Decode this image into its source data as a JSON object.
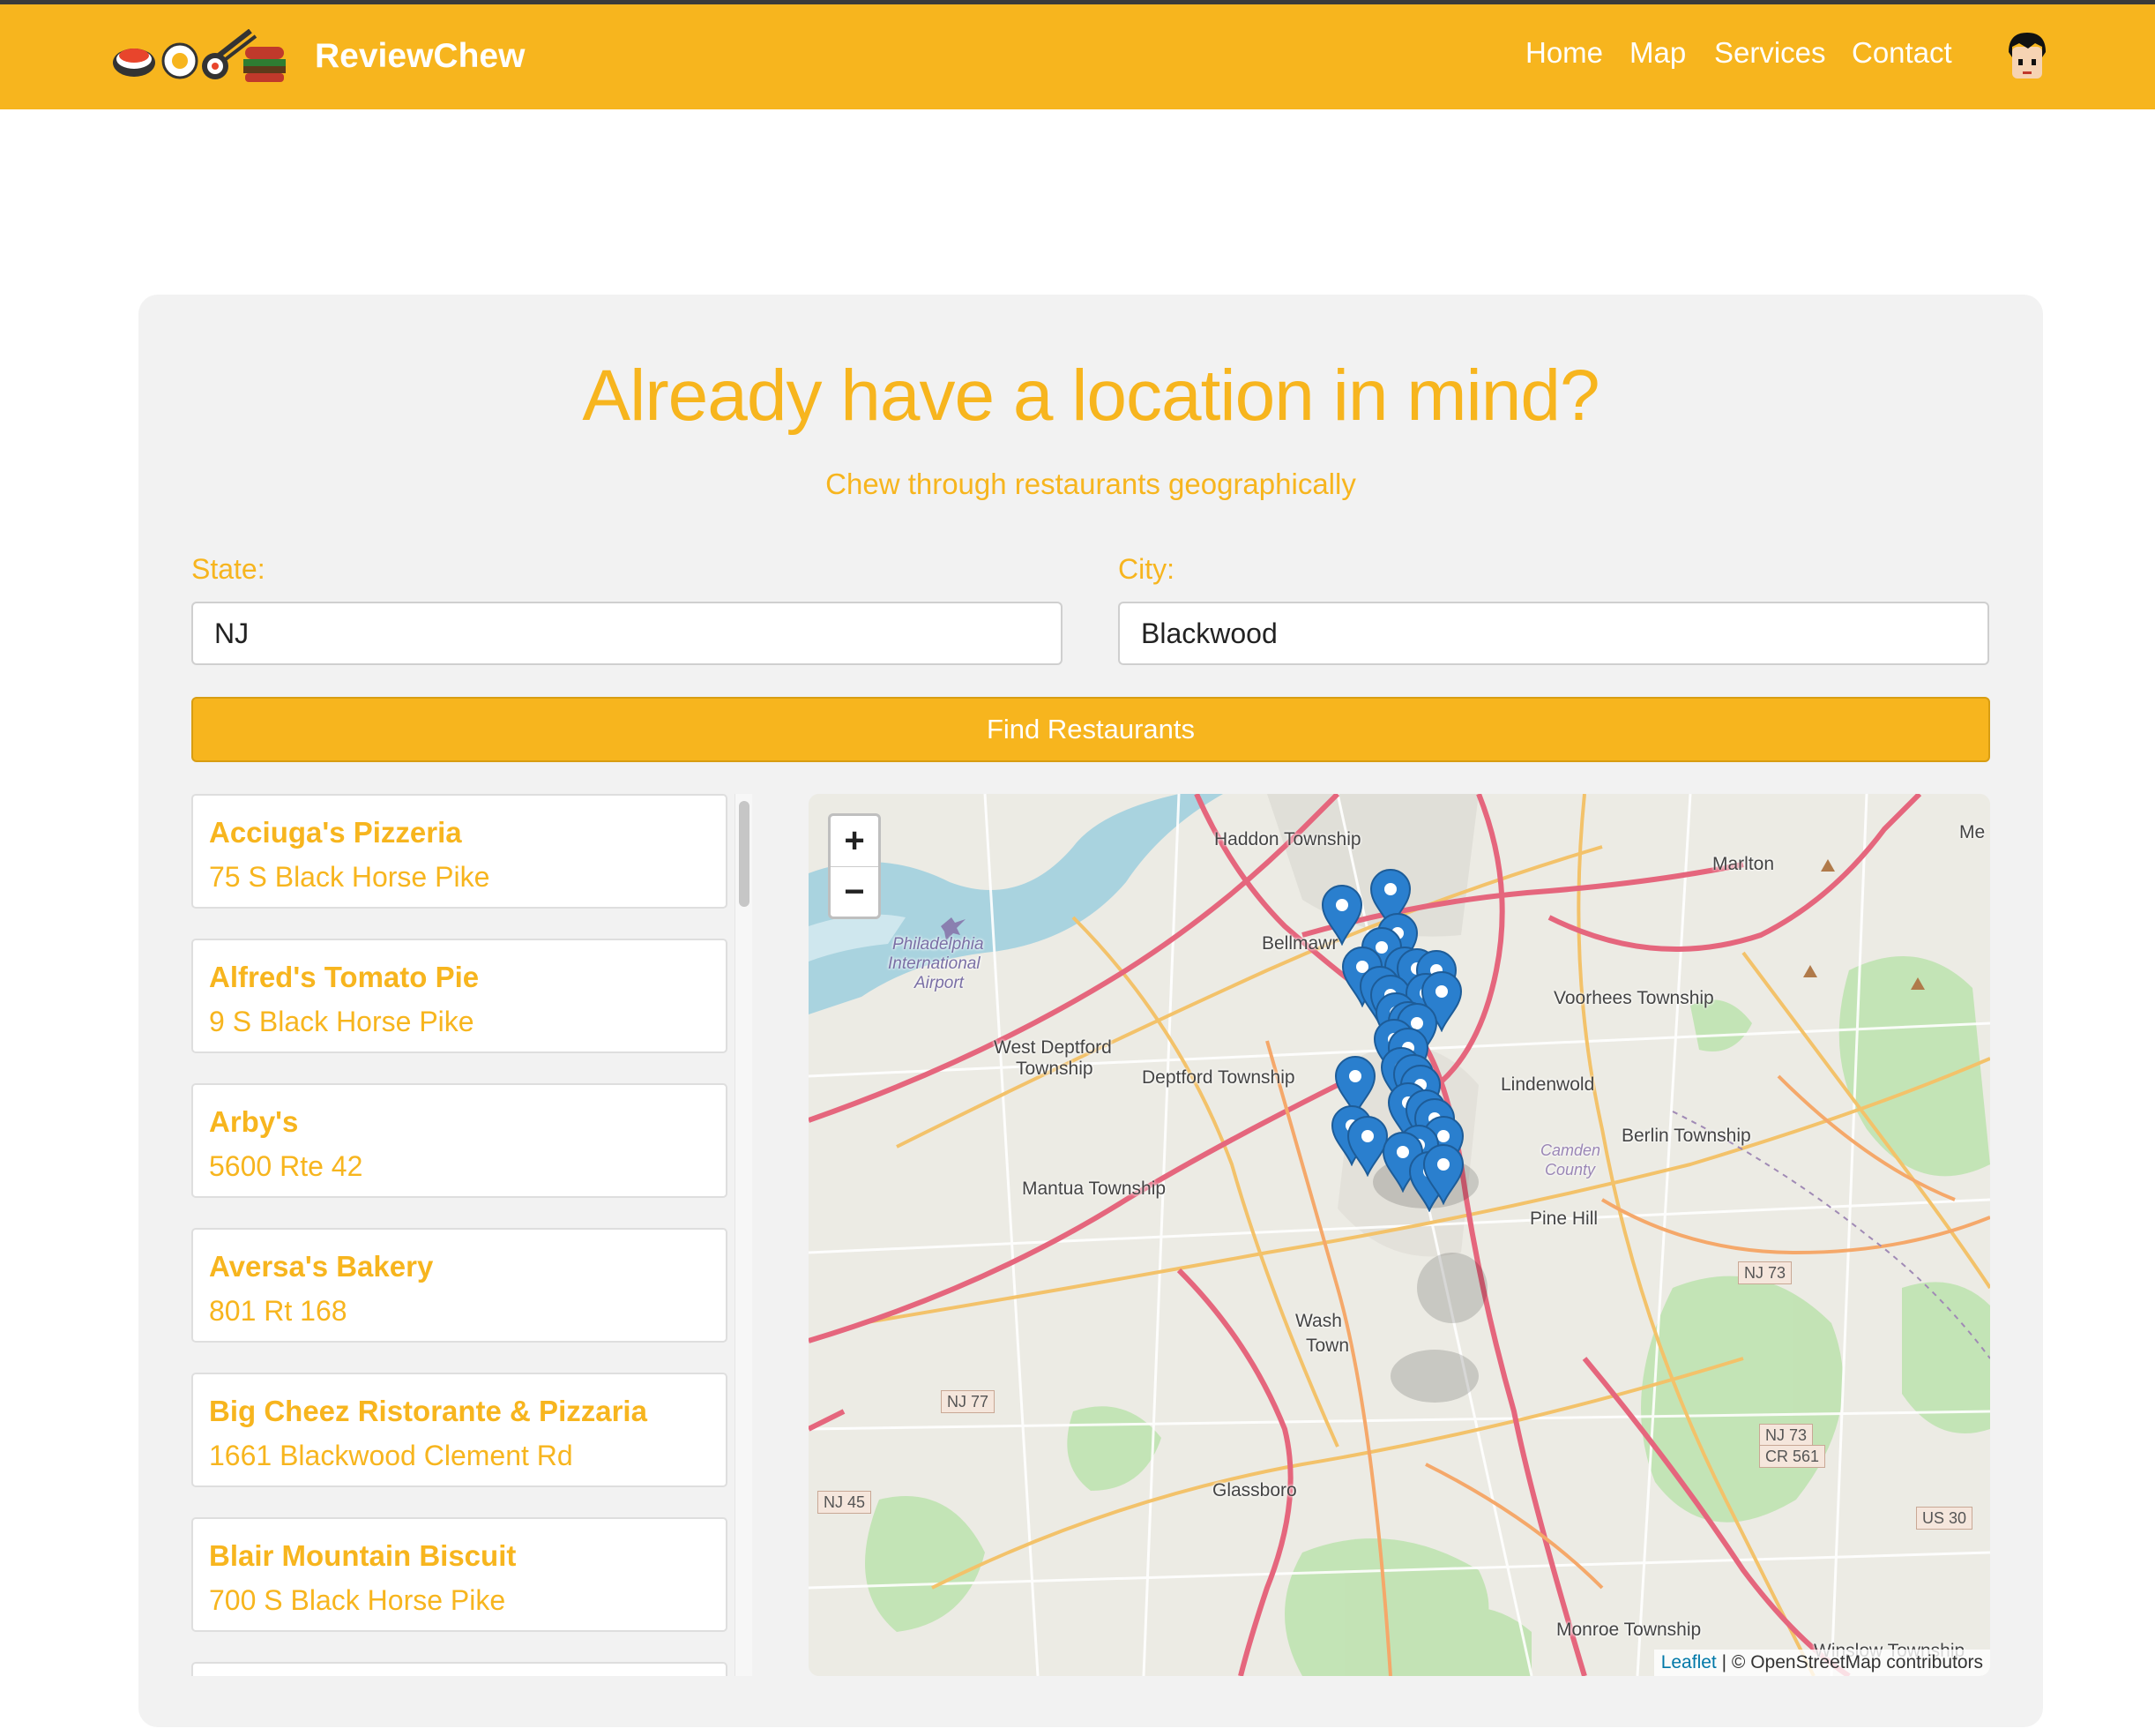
{
  "nav": {
    "brand": "ReviewChew",
    "links": [
      "Home",
      "Map",
      "Services",
      "Contact"
    ]
  },
  "hero": {
    "title": "Already have a location in mind?",
    "subtitle": "Chew through restaurants geographically"
  },
  "form": {
    "state_label": "State:",
    "state_value": "NJ",
    "city_label": "City:",
    "city_value": "Blackwood",
    "button_label": "Find Restaurants"
  },
  "restaurants": [
    {
      "name": "Acciuga's Pizzeria",
      "address": "75 S Black Horse Pike"
    },
    {
      "name": "Alfred's Tomato Pie",
      "address": "9 S Black Horse Pike"
    },
    {
      "name": "Arby's",
      "address": "5600 Rte 42"
    },
    {
      "name": "Aversa's Bakery",
      "address": "801 Rt 168"
    },
    {
      "name": "Big Cheez Ristorante & Pizzaria",
      "address": "1661 Blackwood Clement Rd"
    },
    {
      "name": "Blair Mountain Biscuit",
      "address": "700 S Black Horse Pike"
    }
  ],
  "map": {
    "zoom_in": "+",
    "zoom_out": "−",
    "attribution_link": "Leaflet",
    "attribution_text": " | © OpenStreetMap contributors",
    "labels": {
      "haddon": "Haddon Township",
      "marlton": "Marlton",
      "me": "Me",
      "phl": "Philadelphia",
      "phl2": "International",
      "phl3": "Airport",
      "bellmawr": "Bellmawr",
      "voorhees": "Voorhees Township",
      "west_deptford": "West Deptford",
      "west_deptford2": "Township",
      "deptford": "Deptford Township",
      "lindenwold": "Lindenwold",
      "berlin": "Berlin Township",
      "camden": "Camden",
      "county": "County",
      "mantua": "Mantua Township",
      "pine_hill": "Pine Hill",
      "wash": "Wash",
      "town": "Town",
      "glassboro": "Glassboro",
      "monroe": "Monroe Township",
      "winslow": "Winslow Township"
    },
    "shields": {
      "nj73": "NJ 73",
      "nj77": "NJ 77",
      "nj45": "NJ 45",
      "nj73b": "NJ 73",
      "cr561": "CR 561",
      "us30": "US 30"
    },
    "marker_color": "#2a7fce",
    "land_color": "#ecebe4",
    "water_color": "#a9d3df",
    "park_color": "#bfe3b0"
  },
  "colors": {
    "brand": "#f7b51e",
    "panel": "#f2f2f2"
  }
}
